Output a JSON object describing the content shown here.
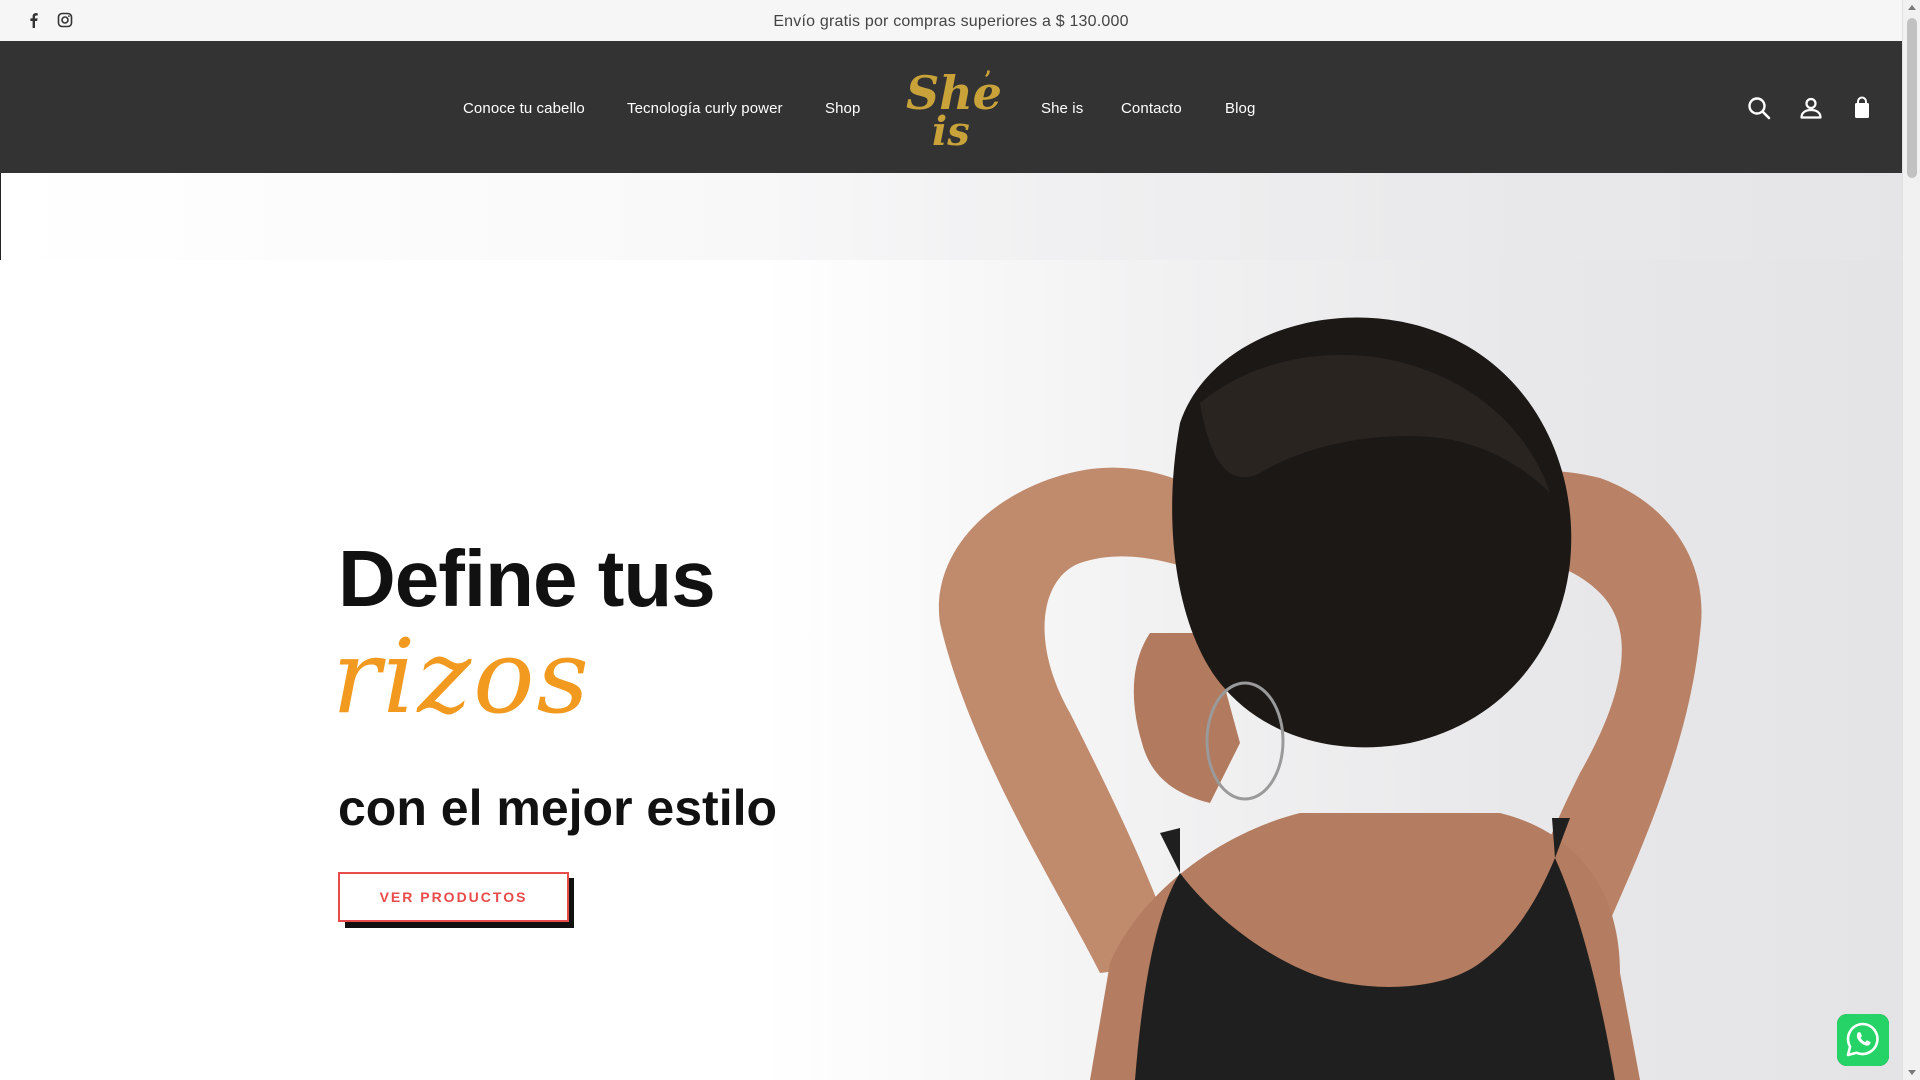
{
  "topbar": {
    "notice": "Envío gratis por compras superiores a $ 130.000",
    "social": [
      {
        "icon": "facebook-icon"
      },
      {
        "icon": "instagram-icon"
      }
    ]
  },
  "nav": {
    "left": [
      "Conoce tu cabello",
      "Tecnología curly power",
      "Shop"
    ],
    "right": [
      "She is",
      "Contacto",
      "Blog"
    ],
    "logo_text": "She is",
    "icons": [
      "search-icon",
      "account-icon",
      "cart-icon"
    ]
  },
  "hero": {
    "line1": "Define tus",
    "line2": "rizos",
    "line3": "con el mejor estilo",
    "cta": "VER PRODUCTOS"
  },
  "floating": {
    "icon": "whatsapp-icon"
  },
  "colors": {
    "topbar_bg": "#f6f6f6",
    "header_bg": "#333333",
    "accent_orange": "#f29a1f",
    "cta_red": "#e94a4a",
    "logo_gold": "#c9a23a",
    "whatsapp_green": "#25d366"
  }
}
